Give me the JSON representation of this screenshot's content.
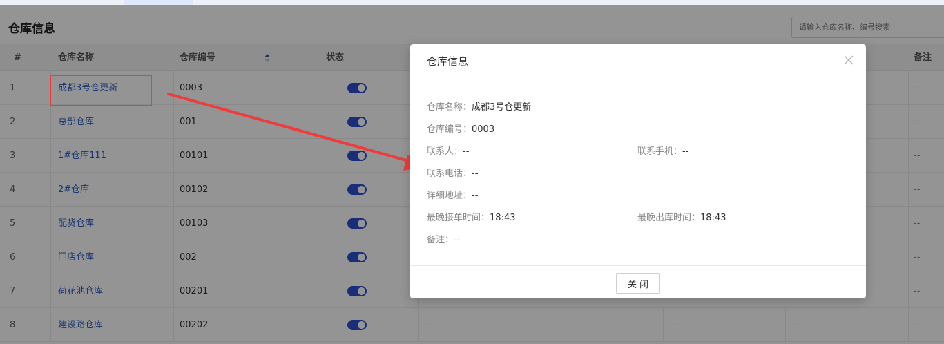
{
  "header": {
    "title": "仓库信息",
    "search_placeholder": "请输入仓库名称、编号搜索"
  },
  "table": {
    "columns": [
      "#",
      "仓库名称",
      "仓库编号",
      "状态",
      "备注"
    ],
    "rows": [
      {
        "idx": "1",
        "name": "成都3号仓更新",
        "code": "0003",
        "remark": "--"
      },
      {
        "idx": "2",
        "name": "总部仓库",
        "code": "001",
        "remark": "--"
      },
      {
        "idx": "3",
        "name": "1#仓库111",
        "code": "00101",
        "remark": "--"
      },
      {
        "idx": "4",
        "name": "2#仓库",
        "code": "00102",
        "remark": "--"
      },
      {
        "idx": "5",
        "name": "配货仓库",
        "code": "00103",
        "remark": "--"
      },
      {
        "idx": "6",
        "name": "门店仓库",
        "code": "002",
        "remark": "--"
      },
      {
        "idx": "7",
        "name": "荷花池仓库",
        "code": "00201",
        "remark": "--"
      },
      {
        "idx": "8",
        "name": "建设路仓库",
        "code": "00202",
        "extra": [
          "--",
          "--",
          "--",
          "--"
        ],
        "remark": "--"
      }
    ]
  },
  "modal": {
    "title": "仓库信息",
    "fields": {
      "name_label": "仓库名称：",
      "name_value": "成都3号仓更新",
      "code_label": "仓库编号：",
      "code_value": "0003",
      "contact_label": "联系人：",
      "contact_value": "--",
      "mobile_label": "联系手机：",
      "mobile_value": "--",
      "phone_label": "联系电话：",
      "phone_value": "--",
      "address_label": "详细地址：",
      "address_value": "--",
      "order_time_label": "最晚接单时间：",
      "order_time_value": "18:43",
      "out_time_label": "最晚出库时间：",
      "out_time_value": "18:43",
      "remark_label": "备注：",
      "remark_value": "--"
    },
    "close_label": "关闭"
  },
  "colors": {
    "accent": "#2b4fcf",
    "link": "#2b5fc7",
    "annotation": "#ef3b3b"
  }
}
